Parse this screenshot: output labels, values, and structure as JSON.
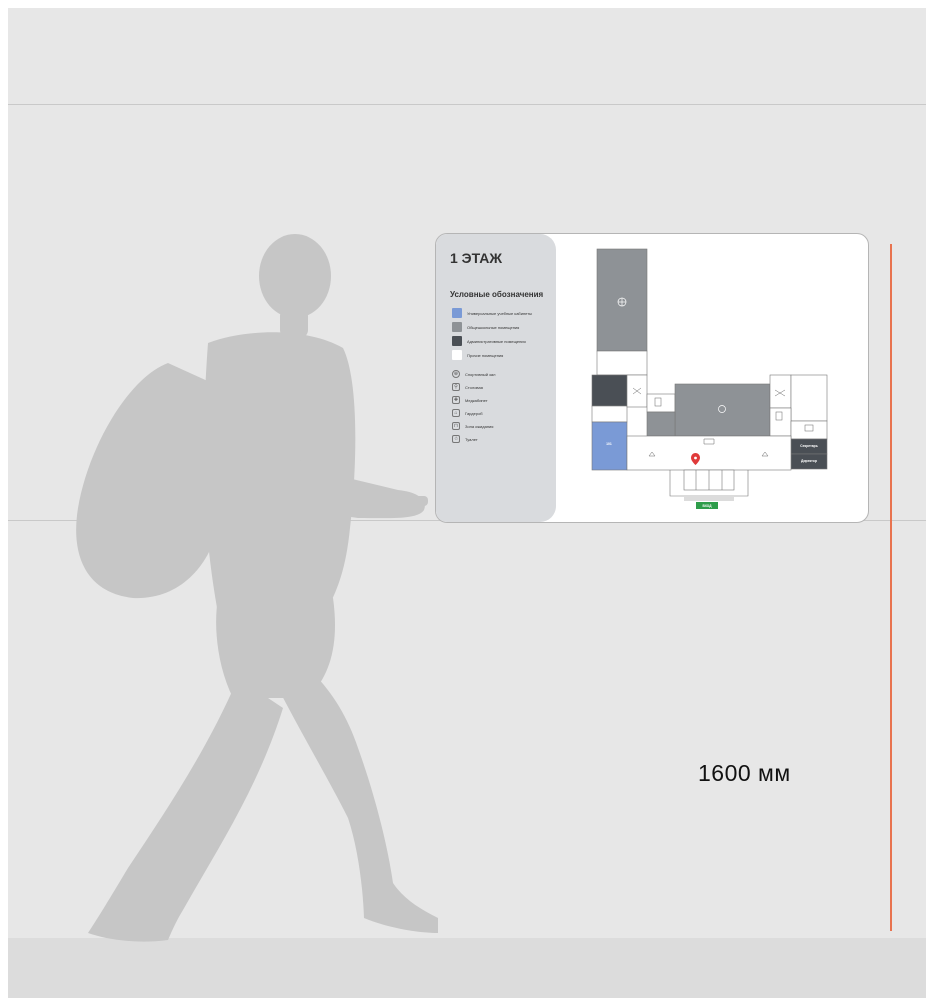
{
  "dimension": {
    "label": "1600 мм",
    "color": "#e8734f"
  },
  "sign": {
    "floor_title": "1 ЭТАЖ",
    "legend_title": "Условные обозначения",
    "legend_colors": [
      {
        "label": "Универсальные учебные кабинеты",
        "color": "#7a9ad6"
      },
      {
        "label": "Общешкольные помещения",
        "color": "#8e9296"
      },
      {
        "label": "Административные помещения",
        "color": "#4a4f55"
      },
      {
        "label": "Прочие помещения",
        "color": "#ffffff"
      }
    ],
    "legend_icons": [
      {
        "label": "Спортивный зал",
        "icon": "sports-hall-icon",
        "glyph": "⊕",
        "round": true
      },
      {
        "label": "Столовая",
        "icon": "canteen-icon",
        "glyph": "⚲",
        "round": false
      },
      {
        "label": "Медкабинет",
        "icon": "medical-office-icon",
        "glyph": "✚",
        "round": false
      },
      {
        "label": "Гардероб",
        "icon": "wardrobe-icon",
        "glyph": "⌂",
        "round": false
      },
      {
        "label": "Зона ожидания",
        "icon": "waiting-area-icon",
        "glyph": "⊓",
        "round": false
      },
      {
        "label": "Туалет",
        "icon": "toilet-icon",
        "glyph": "☃",
        "round": false
      }
    ],
    "map": {
      "room_label_blue": "101",
      "secretary_label": "Секретарь",
      "director_label": "Директор",
      "exit_label": "ВХОД",
      "location_pin": "location-pin-icon",
      "pin_color": "#e03a3a"
    }
  }
}
